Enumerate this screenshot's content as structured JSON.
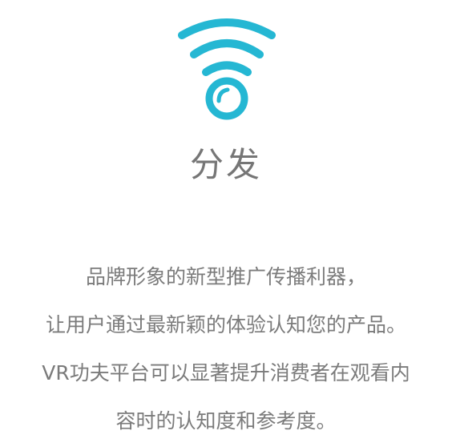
{
  "title": "分发",
  "icon": {
    "name": "wifi-icon",
    "color": "#25b7d3"
  },
  "description_lines": [
    "品牌形象的新型推广传播利器，",
    "让用户通过最新颖的体验认知您的产品。",
    "VR功夫平台可以显著提升消费者在观看内",
    "容时的认知度和参考度。"
  ]
}
